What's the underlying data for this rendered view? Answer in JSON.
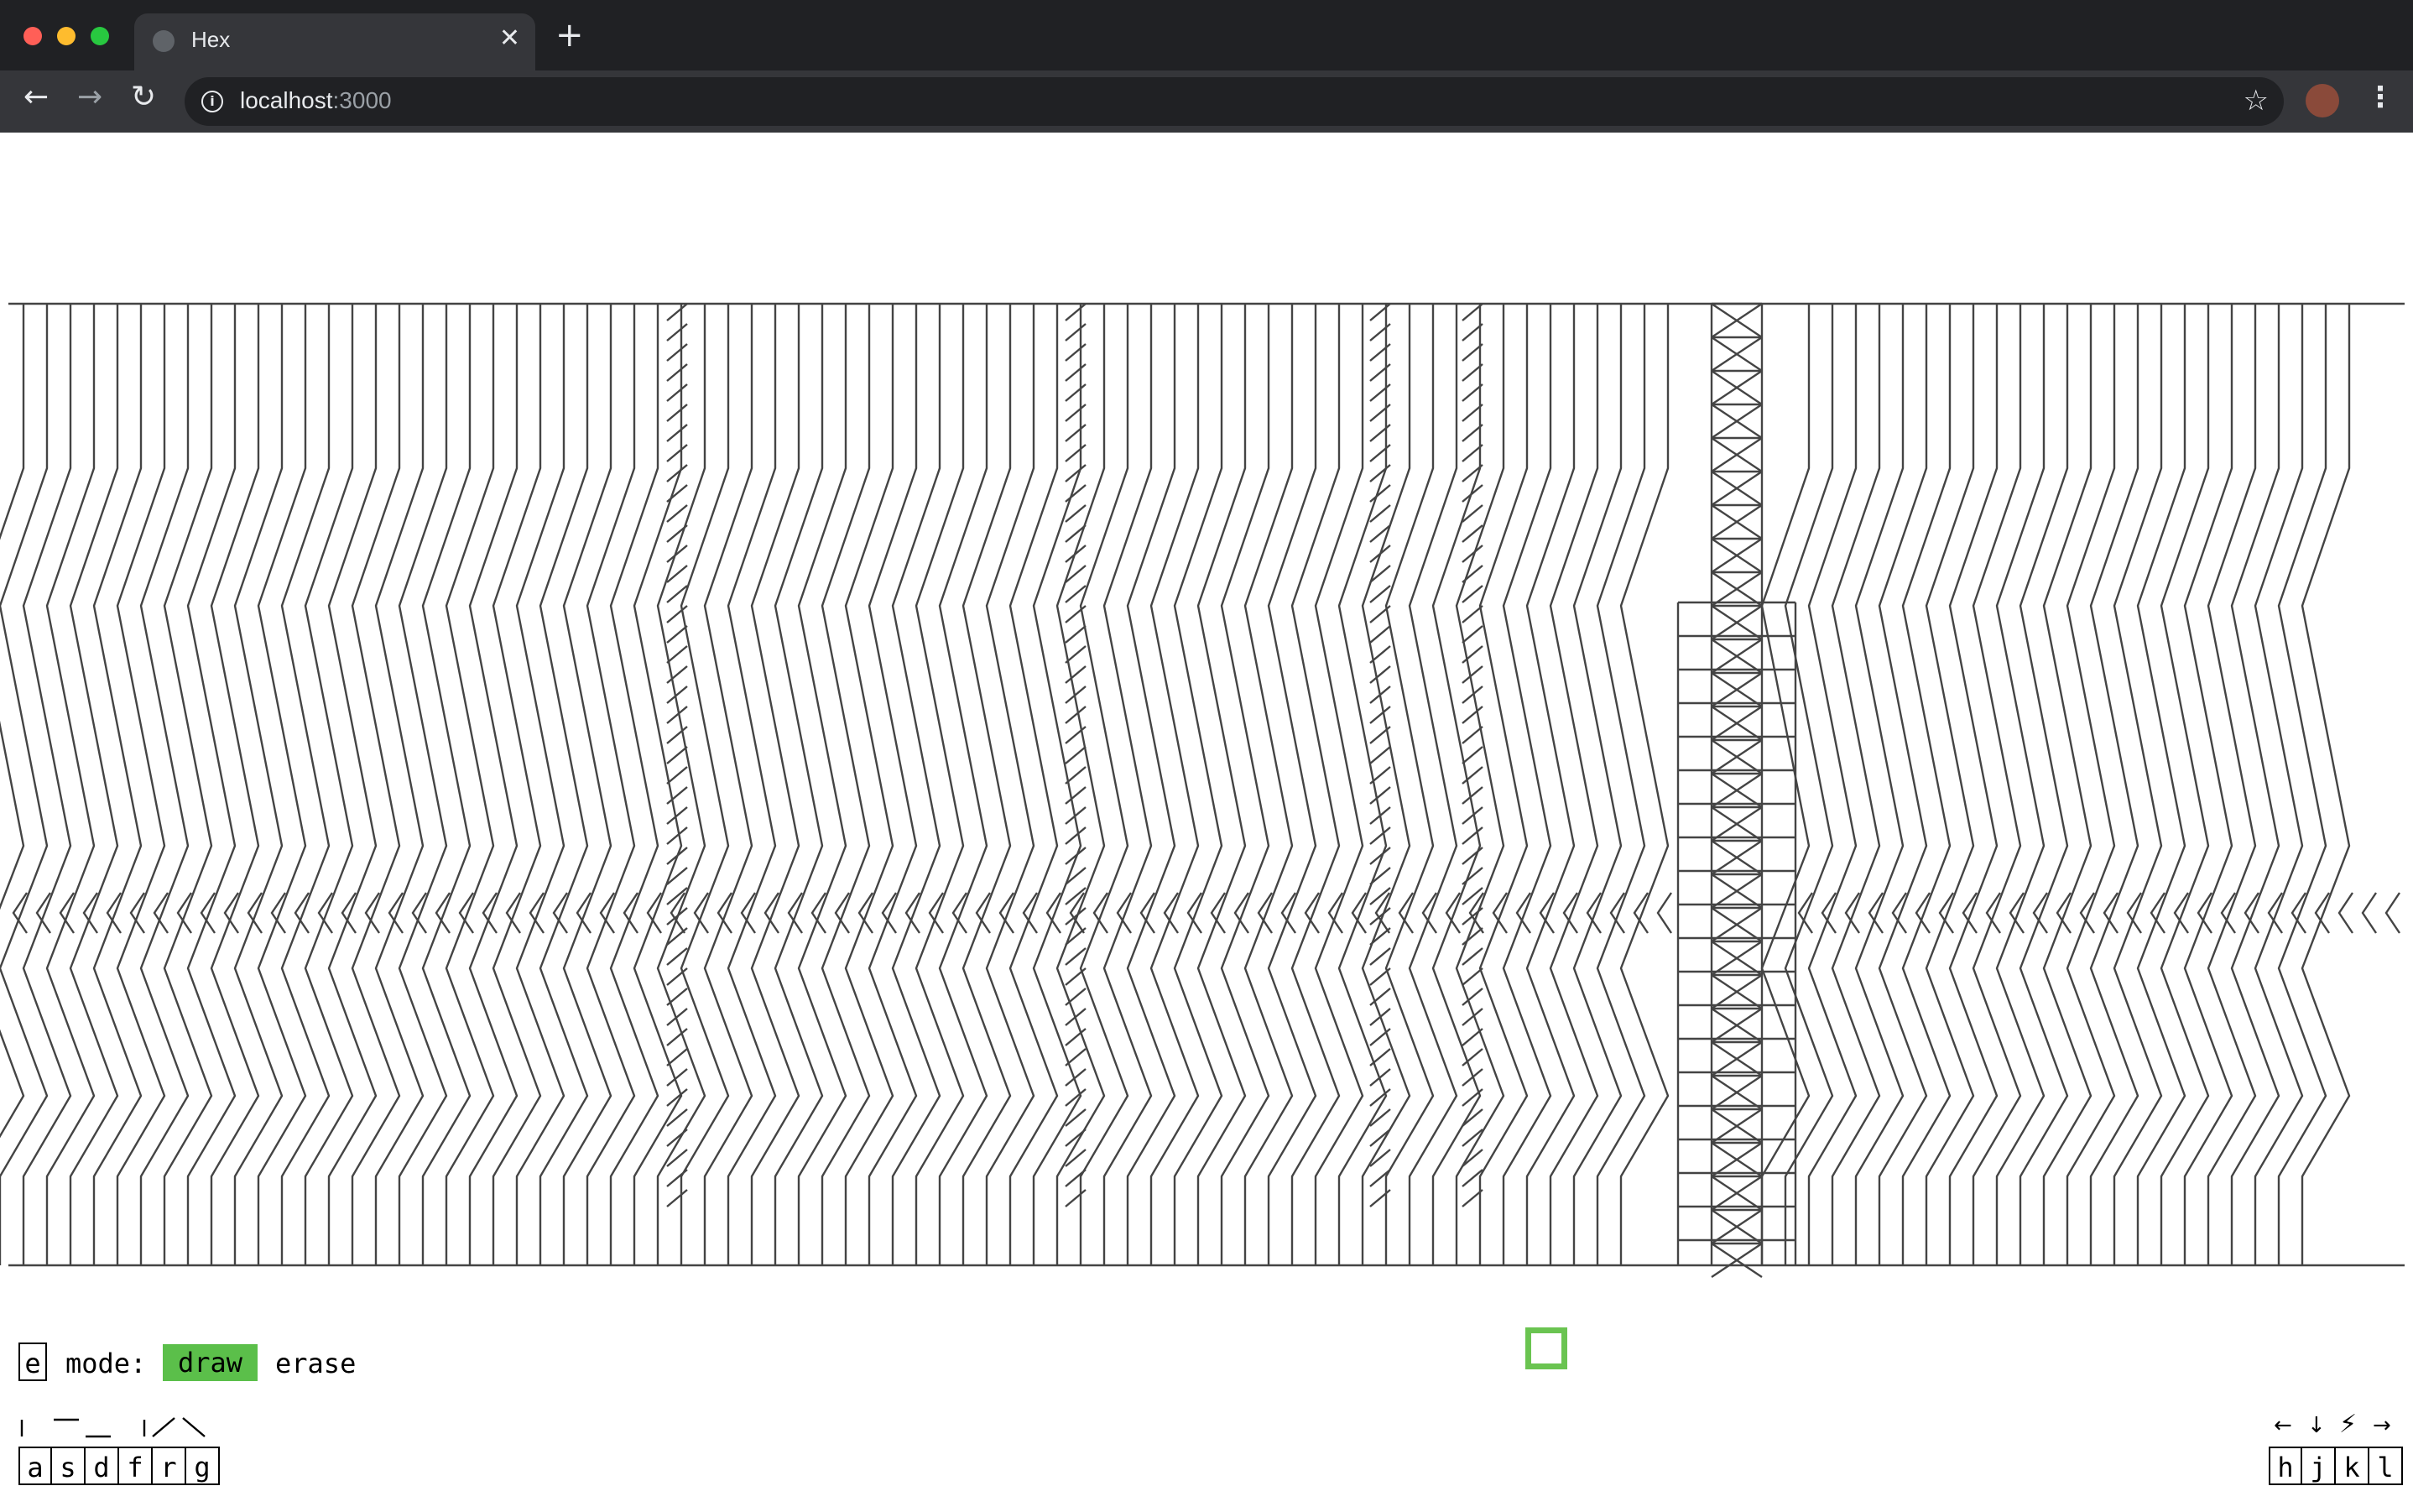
{
  "browser": {
    "tab_title": "Hex",
    "close_icon": "close-icon",
    "new_tab_label": "+",
    "url_host": "localhost",
    "url_port": ":3000",
    "back_icon": "←",
    "forward_icon": "→",
    "reload_icon": "↻",
    "star_icon": "☆",
    "menu_icon": "⋮",
    "info_icon": "i",
    "traffic_colors": [
      "#ff5f57",
      "#febc2e",
      "#28c840"
    ]
  },
  "editor": {
    "mode_key": "e",
    "mode_label": "mode:",
    "mode_options": [
      "draw",
      "erase"
    ],
    "active_mode": "draw",
    "active_color": "#5bbf4a",
    "cursor_color": "#6ac451",
    "tool_keys": [
      "a",
      "s",
      "d",
      "f",
      "r",
      "g"
    ],
    "tool_glyphs": [
      "vertical-line-icon",
      "top-line-icon",
      "bottom-line-icon",
      "vertical-line-icon",
      "diagonal-up-icon",
      "diagonal-down-icon"
    ],
    "nav_keys": [
      "h",
      "j",
      "k",
      "l"
    ],
    "nav_arrows": [
      "←",
      "↓",
      "⚡",
      "→"
    ]
  }
}
